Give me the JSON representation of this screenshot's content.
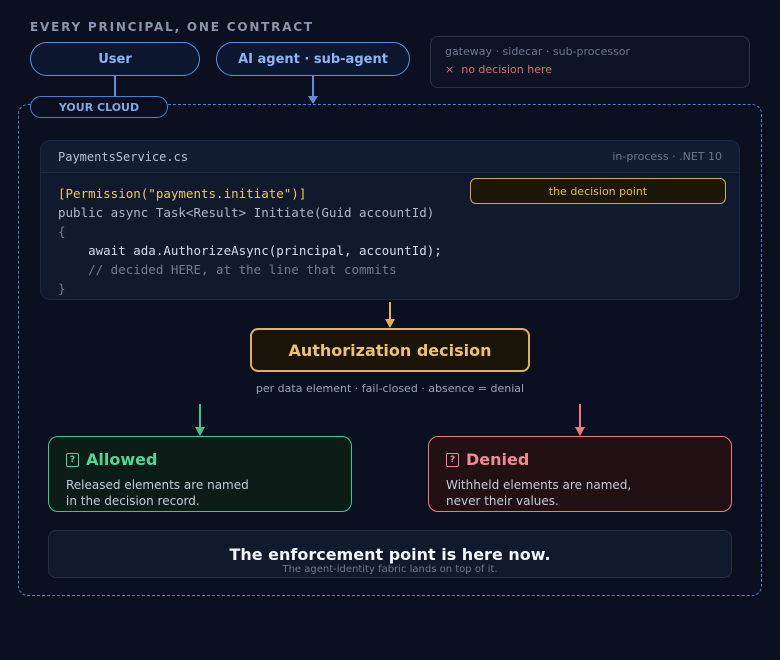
{
  "eyebrow": "EVERY PRINCIPAL, ONE CONTRACT",
  "principals": {
    "user": "User",
    "agent": "AI agent · sub-agent"
  },
  "side_note": {
    "items": "gateway · sidecar · sub-processor",
    "warning": "no decision here",
    "warning_icon": "×"
  },
  "cloud_label": "YOUR CLOUD",
  "code": {
    "file": "PaymentsService.cs",
    "meta": "in-process · .NET 10",
    "line1": "[Permission(\"payments.initiate\")]",
    "line2": "public async Task<Result> Initiate(Guid accountId)",
    "line3": "{",
    "line4": "    await ada.AuthorizeAsync(principal, accountId);",
    "line5": "    // decided HERE, at the line that commits",
    "line6": "}"
  },
  "decision_point": "the decision point",
  "auth": {
    "title": "Authorization decision",
    "subtitle": "per data element · fail-closed · absence = denial"
  },
  "allowed": {
    "title": "Allowed",
    "text1": "Released elements are named",
    "text2": "in the decision record."
  },
  "denied": {
    "title": "Denied",
    "text1": "Withheld elements are named,",
    "text2": "never their values."
  },
  "enforcement": {
    "title": "The enforcement point is here now.",
    "subtitle": "The agent-identity fabric lands on top of it."
  },
  "colors": {
    "blue": "#5f8fdc",
    "gold": "#e0b256",
    "green": "#3fc48a",
    "red": "#ee7b80"
  }
}
